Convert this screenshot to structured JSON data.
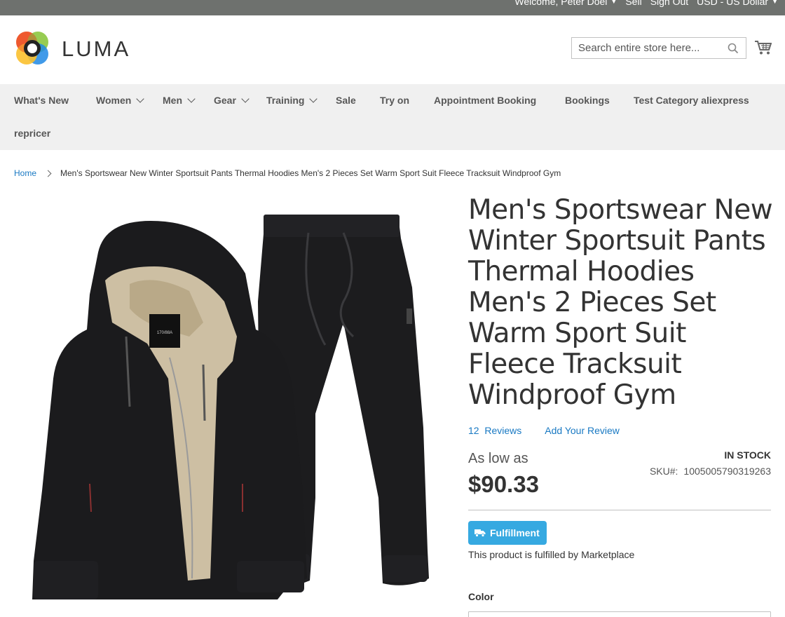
{
  "top_bar": {
    "welcome": "Welcome, Peter Doel",
    "sell": "Sell",
    "sign_out": "Sign Out",
    "currency": "USD - US Dollar"
  },
  "header": {
    "logo_text": "LUMA",
    "search_placeholder": "Search entire store here..."
  },
  "nav": {
    "items": [
      {
        "label": "What's New",
        "has_dropdown": false
      },
      {
        "label": "Women",
        "has_dropdown": true
      },
      {
        "label": "Men",
        "has_dropdown": true
      },
      {
        "label": "Gear",
        "has_dropdown": true
      },
      {
        "label": "Training",
        "has_dropdown": true
      },
      {
        "label": "Sale",
        "has_dropdown": false
      },
      {
        "label": "Try on",
        "has_dropdown": false
      },
      {
        "label": "Appointment Booking",
        "has_dropdown": false
      },
      {
        "label": "Bookings",
        "has_dropdown": false
      },
      {
        "label": "Test Category aliexpress",
        "has_dropdown": false
      },
      {
        "label": "repricer",
        "has_dropdown": false
      }
    ]
  },
  "breadcrumb": {
    "home": "Home",
    "current": "Men's Sportswear New Winter Sportsuit Pants Thermal Hoodies Men's 2 Pieces Set Warm Sport Suit Fleece Tracksuit Windproof Gym"
  },
  "product": {
    "title": "Men's Sportswear New Winter Sportsuit Pants Thermal Hoodies Men's 2 Pieces Set Warm Sport Suit Fleece Tracksuit Windproof Gym",
    "reviews_count": "12",
    "reviews_label": "Reviews",
    "add_review": "Add Your Review",
    "price_prefix": "As low as",
    "price": "$90.33",
    "stock": "In stock",
    "sku_label": "SKU#:",
    "sku": "1005005790319263",
    "fulfillment_badge": "Fulfillment",
    "fulfillment_note": "This product is fulfilled by Marketplace",
    "color_label": "Color",
    "image_tag": "170/88A"
  },
  "colors": {
    "link": "#1979c3",
    "badge": "#36a9e1",
    "nav_bg": "#f0f0f0",
    "top_bar_bg": "#6e716e"
  }
}
